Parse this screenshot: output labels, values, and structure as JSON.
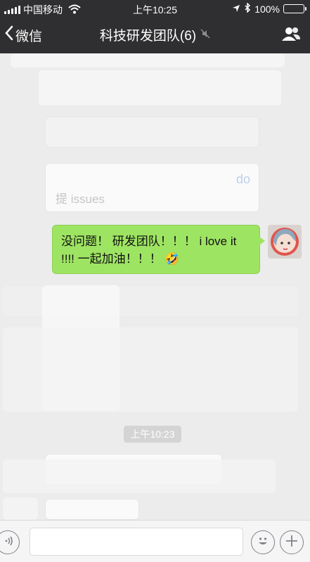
{
  "status_bar": {
    "carrier": "中国移动",
    "time": "上午10:25",
    "battery_text": "100%",
    "battery_level": 1.0
  },
  "nav": {
    "back_label": "微信",
    "title": "科技研发团队(6)"
  },
  "messages": {
    "ghost_link_text": "do",
    "ghost_issues_text": "提 issues",
    "outgoing_text": "没问题！ 研发团队！！！ i love it !!!! 一起加油！！！ 🤣",
    "time_label": "上午10:23"
  },
  "colors": {
    "topbar": "#2f2f31",
    "outgoing_bubble": "#9ee463",
    "chat_bg": "#ececec"
  },
  "icons": [
    "signal-icon",
    "wifi-icon",
    "location-icon",
    "bluetooth-icon",
    "battery-icon",
    "back-chevron-icon",
    "mute-icon",
    "members-icon",
    "voice-icon",
    "emoji-icon",
    "plus-icon"
  ]
}
